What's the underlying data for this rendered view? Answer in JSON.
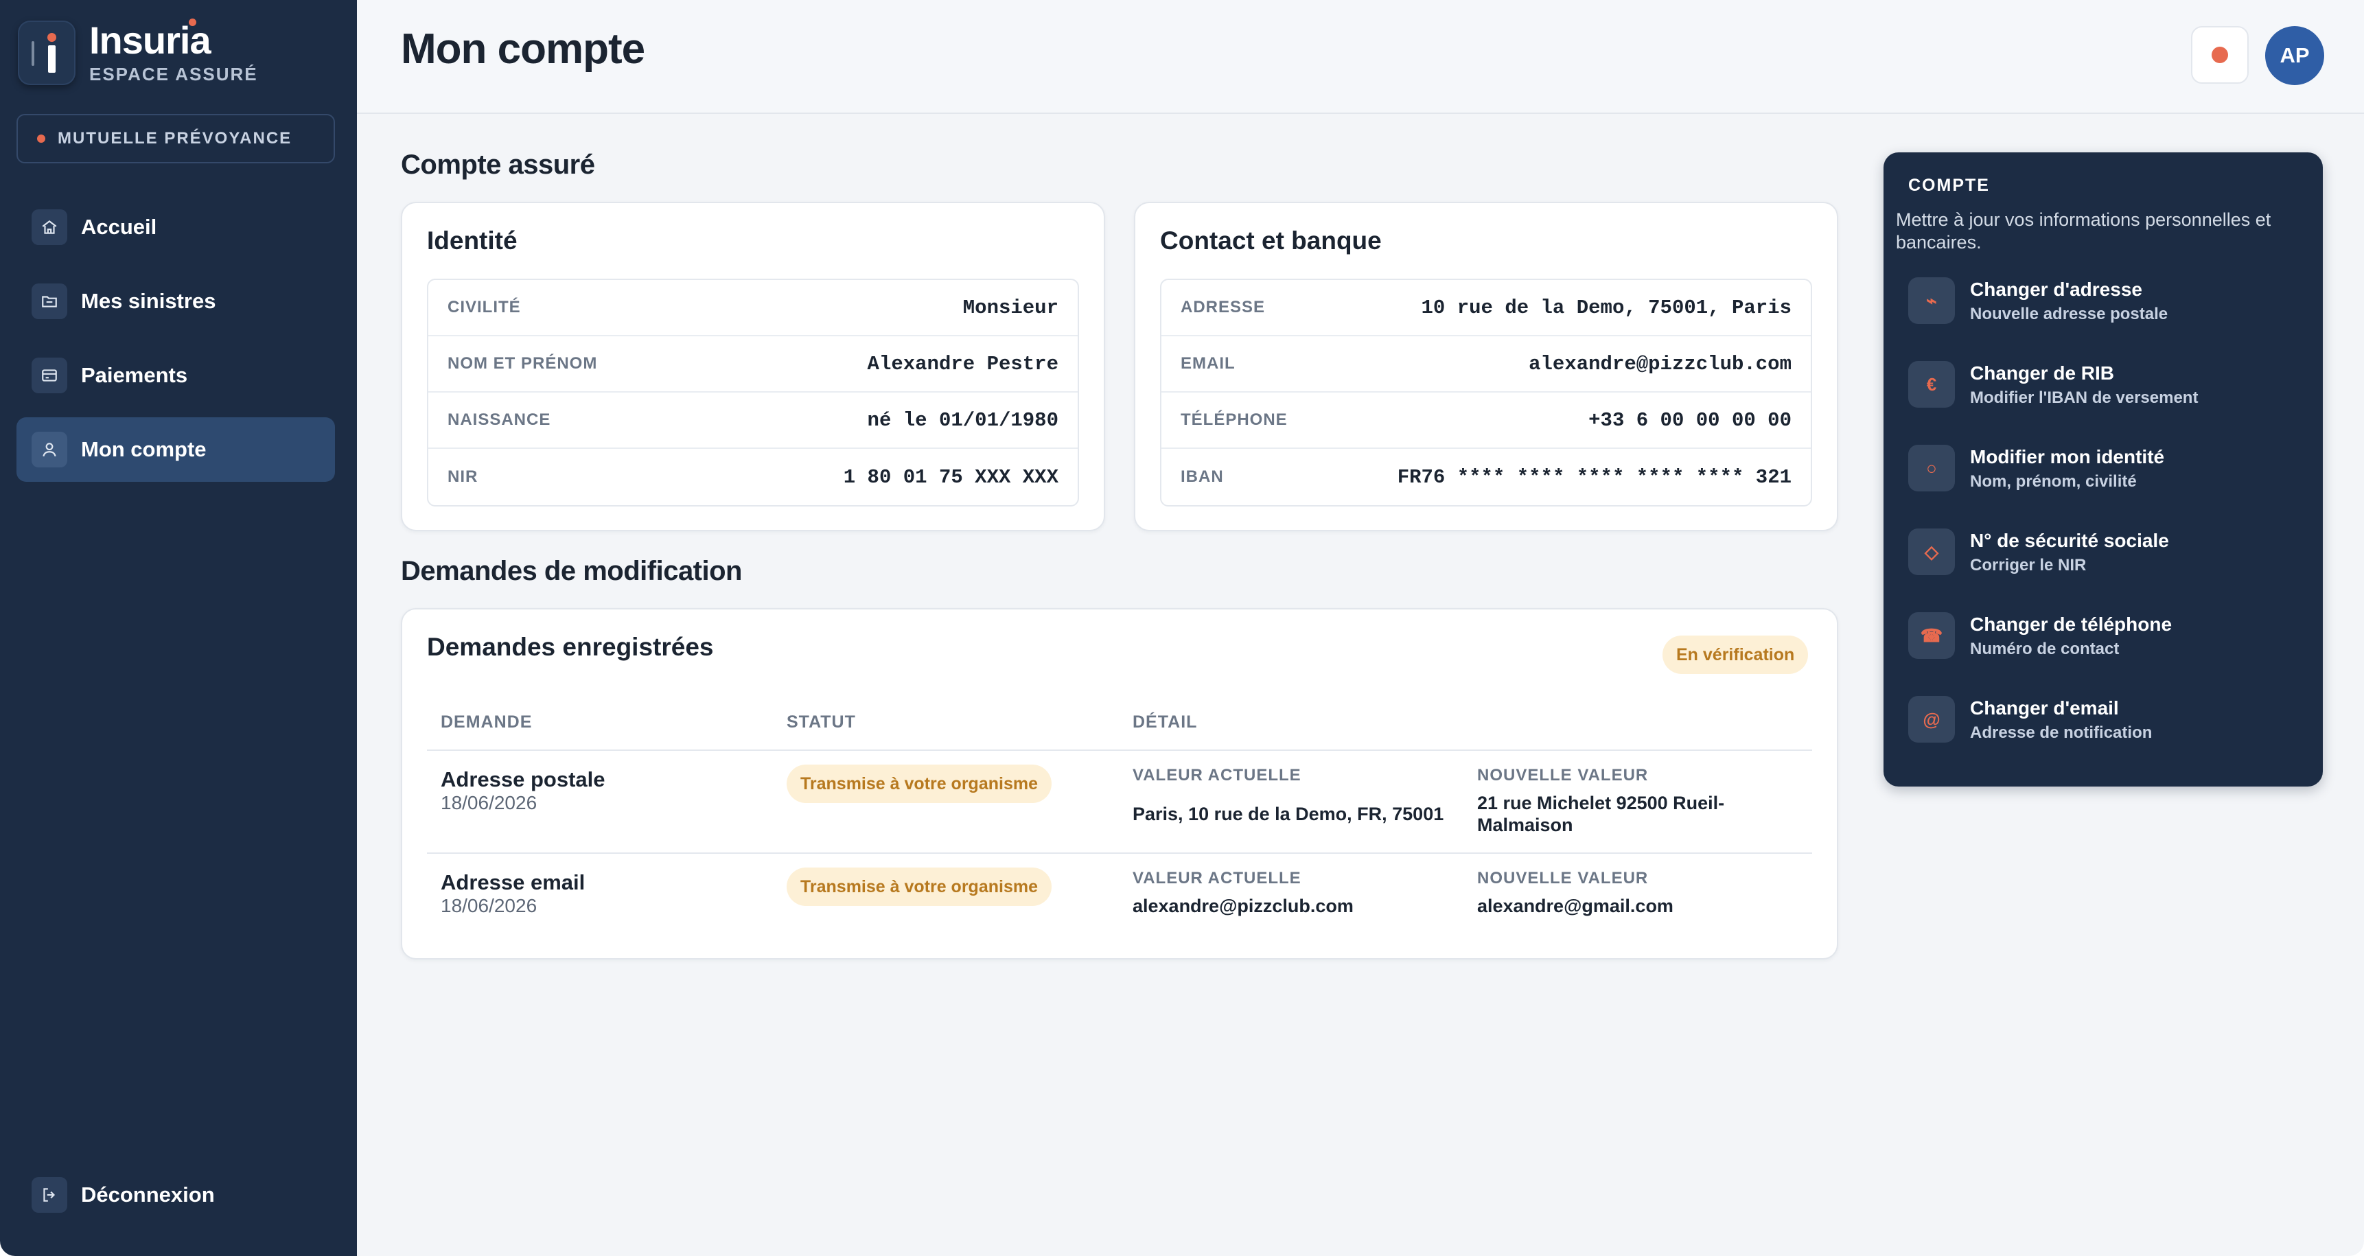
{
  "brand": {
    "name": "Insuria",
    "subtitle": "ESPACE ASSURÉ"
  },
  "organization": {
    "label": "MUTUELLE PRÉVOYANCE"
  },
  "nav": {
    "items": [
      {
        "label": "Accueil",
        "icon": "home-icon"
      },
      {
        "label": "Mes sinistres",
        "icon": "folder-icon"
      },
      {
        "label": "Paiements",
        "icon": "card-icon"
      },
      {
        "label": "Mon compte",
        "icon": "user-icon",
        "active": true
      }
    ],
    "logout": "Déconnexion"
  },
  "header": {
    "title": "Mon compte",
    "avatar_initials": "AP"
  },
  "account": {
    "section_title": "Compte assuré",
    "identity": {
      "title": "Identité",
      "rows": [
        {
          "label": "CIVILITÉ",
          "value": "Monsieur"
        },
        {
          "label": "NOM ET PRÉNOM",
          "value": "Alexandre Pestre"
        },
        {
          "label": "NAISSANCE",
          "value": "né le 01/01/1980"
        },
        {
          "label": "NIR",
          "value": "1 80 01 75 XXX XXX"
        }
      ]
    },
    "contact": {
      "title": "Contact et banque",
      "rows": [
        {
          "label": "ADRESSE",
          "value": "10 rue de la Demo, 75001, Paris"
        },
        {
          "label": "EMAIL",
          "value": "alexandre@pizzclub.com"
        },
        {
          "label": "TÉLÉPHONE",
          "value": "+33 6 00 00 00 00"
        },
        {
          "label": "IBAN",
          "value": "FR76 **** **** **** **** **** 321"
        }
      ]
    }
  },
  "requests": {
    "section_title": "Demandes de modification",
    "card_title": "Demandes enregistrées",
    "status_chip": "En vérification",
    "columns": [
      "DEMANDE",
      "STATUT",
      "DÉTAIL"
    ],
    "current_label": "VALEUR ACTUELLE",
    "new_label": "NOUVELLE VALEUR",
    "rows": [
      {
        "title": "Adresse postale",
        "date": "18/06/2026",
        "status": "Transmise à votre organisme",
        "current": "Paris, 10 rue de la Demo, FR, 75001",
        "new": "21 rue Michelet 92500 Rueil-Malmaison"
      },
      {
        "title": "Adresse email",
        "date": "18/06/2026",
        "status": "Transmise à votre organisme",
        "current": "alexandre@pizzclub.com",
        "new": "alexandre@gmail.com"
      }
    ]
  },
  "panel": {
    "title": "COMPTE",
    "description": "Mettre à jour vos informations personnelles et bancaires.",
    "actions": [
      {
        "title": "Changer d'adresse",
        "subtitle": "Nouvelle adresse postale",
        "icon": "pin-icon",
        "glyph": "⌁"
      },
      {
        "title": "Changer de RIB",
        "subtitle": "Modifier l'IBAN de versement",
        "icon": "euro-icon",
        "glyph": "€"
      },
      {
        "title": "Modifier mon identité",
        "subtitle": "Nom, prénom, civilité",
        "icon": "circle-icon",
        "glyph": "○"
      },
      {
        "title": "N° de sécurité sociale",
        "subtitle": "Corriger le NIR",
        "icon": "diamond-icon",
        "glyph": "◇"
      },
      {
        "title": "Changer de téléphone",
        "subtitle": "Numéro de contact",
        "icon": "phone-icon",
        "glyph": "☎"
      },
      {
        "title": "Changer d'email",
        "subtitle": "Adresse de notification",
        "icon": "at-icon",
        "glyph": "@"
      }
    ]
  },
  "colors": {
    "sidebar": "#1c2c44",
    "accent": "#e76a4f",
    "avatar": "#2f5ea6",
    "chip_bg": "#fdf0d6",
    "chip_text": "#b7791f"
  }
}
